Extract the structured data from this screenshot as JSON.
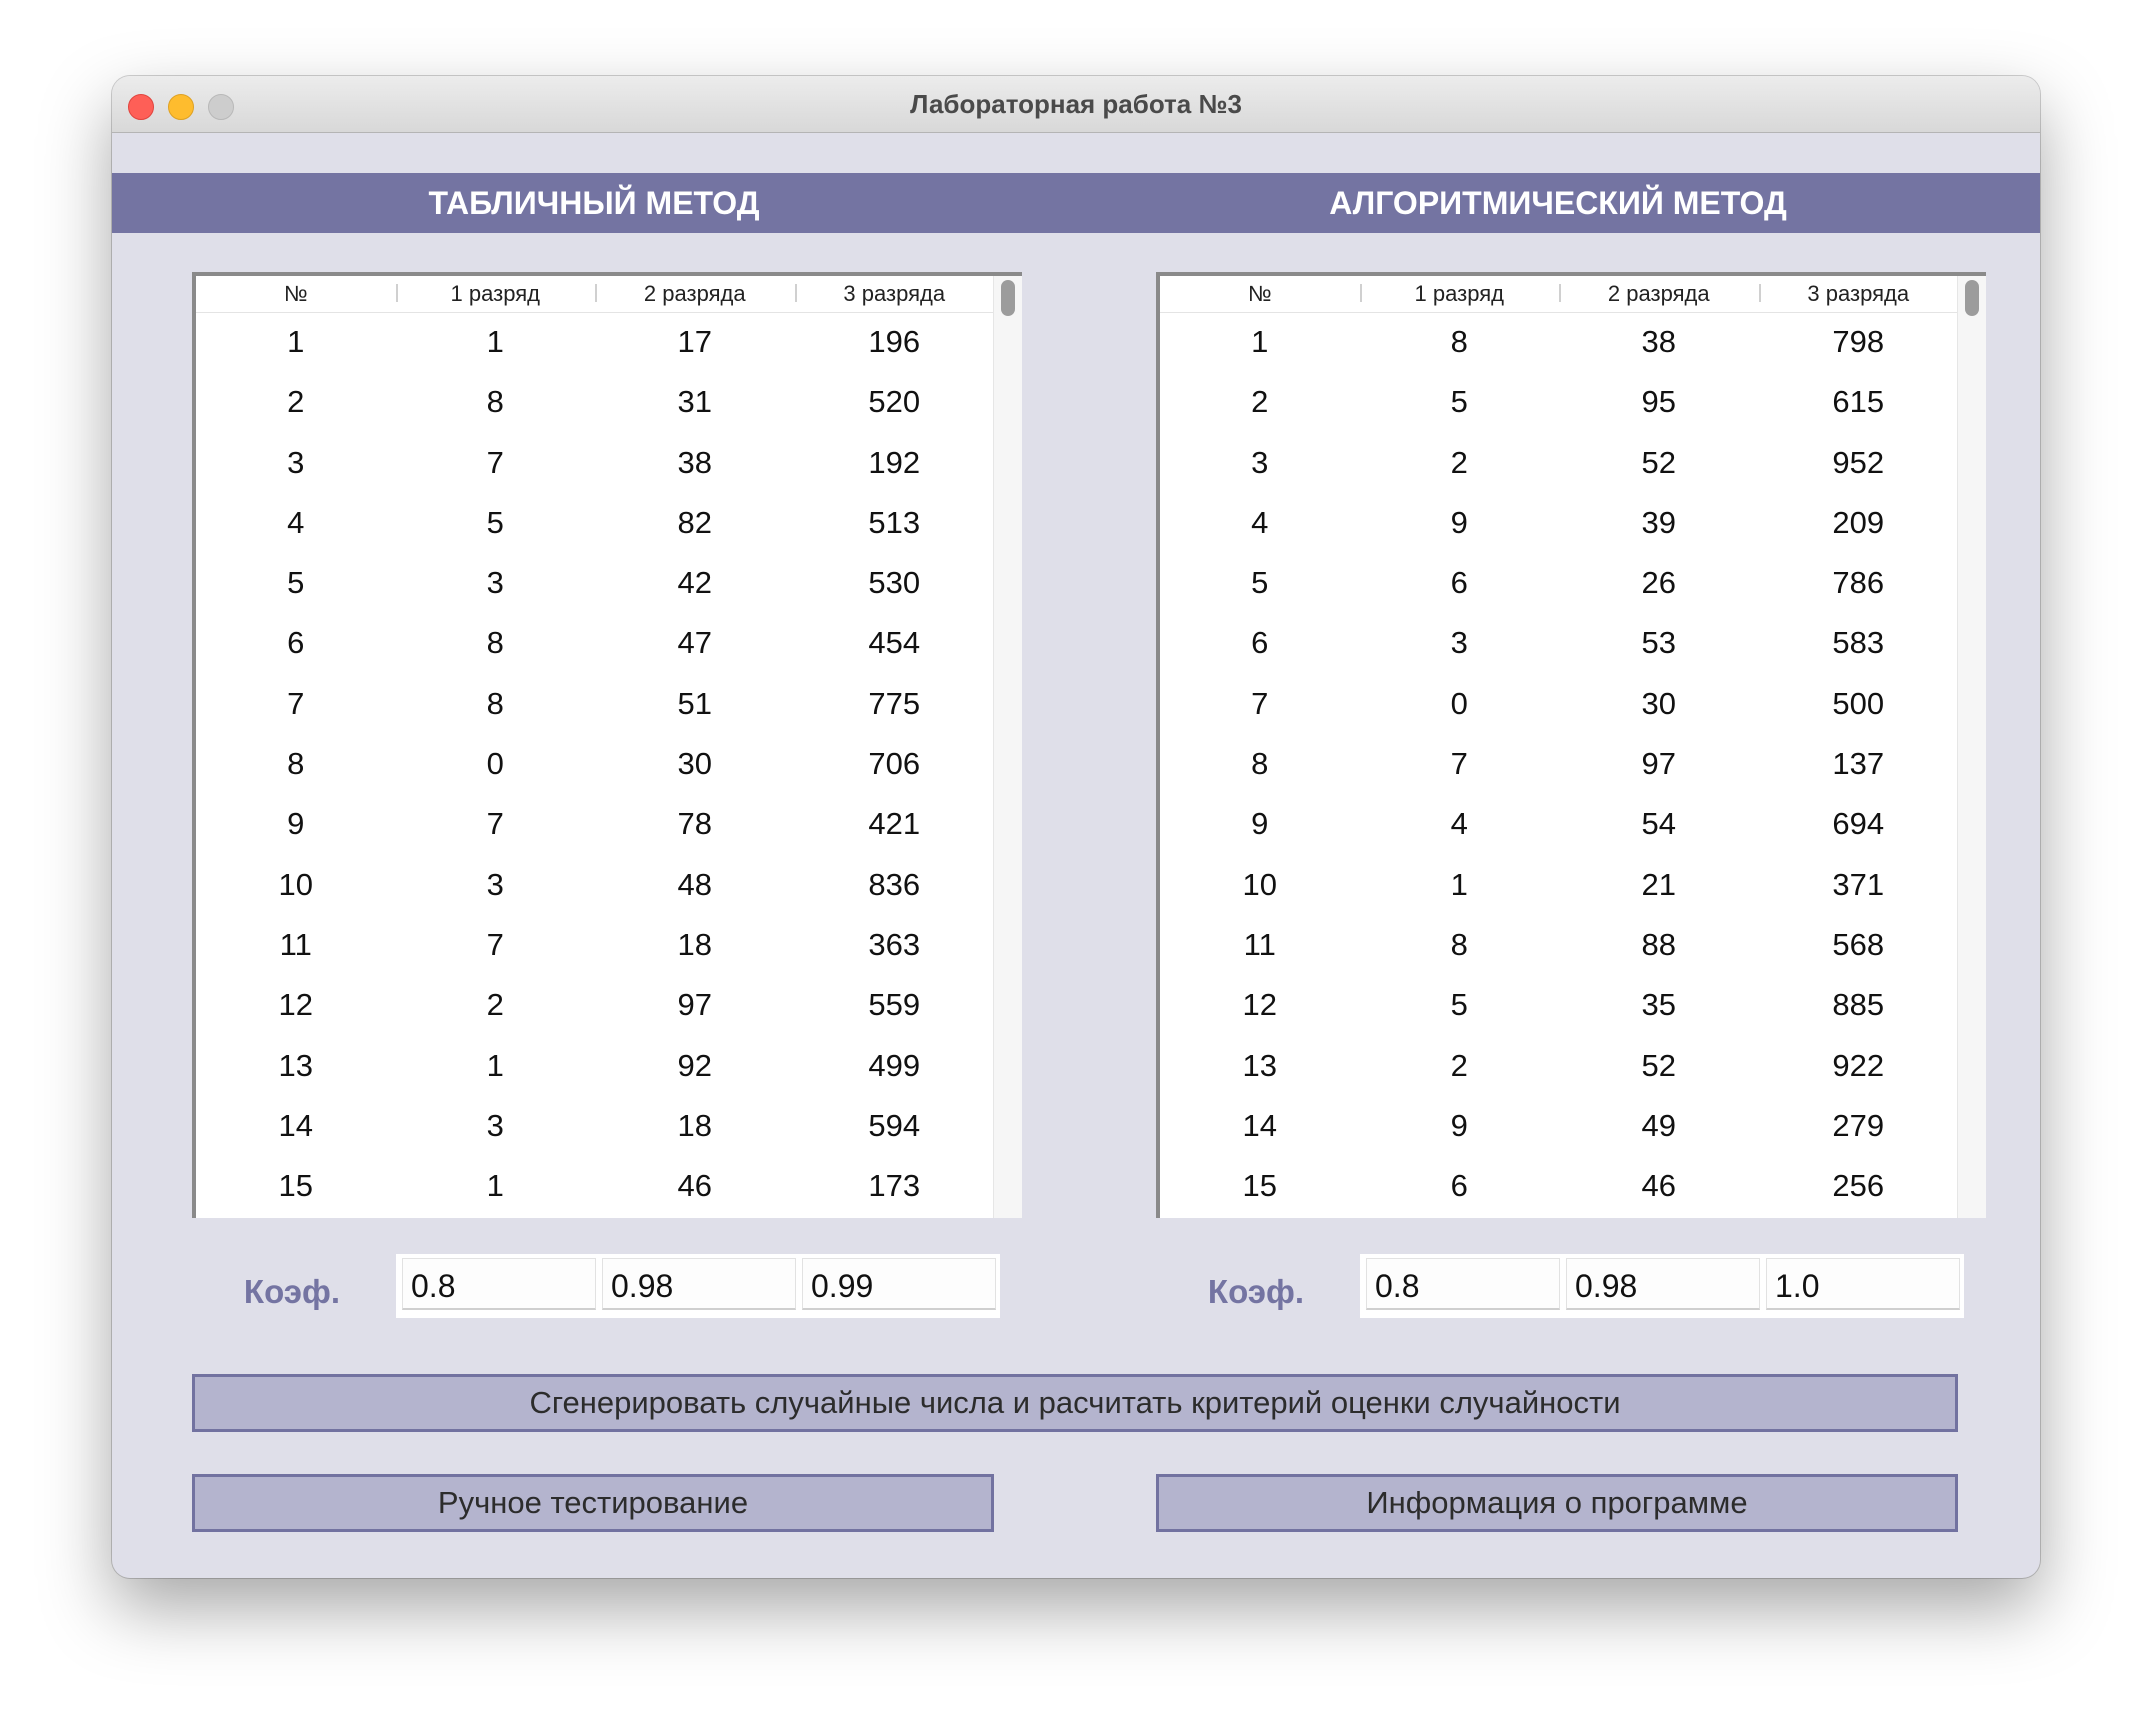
{
  "window": {
    "title": "Лабораторная работа №3"
  },
  "sections": {
    "left_title": "ТАБЛИЧНЫЙ МЕТОД",
    "right_title": "АЛГОРИТМИЧЕСКИЙ МЕТОД"
  },
  "table_headers": [
    "№",
    "1 разряд",
    "2 разряда",
    "3 разряда"
  ],
  "left_table": {
    "rows": [
      [
        "1",
        "1",
        "17",
        "196"
      ],
      [
        "2",
        "8",
        "31",
        "520"
      ],
      [
        "3",
        "7",
        "38",
        "192"
      ],
      [
        "4",
        "5",
        "82",
        "513"
      ],
      [
        "5",
        "3",
        "42",
        "530"
      ],
      [
        "6",
        "8",
        "47",
        "454"
      ],
      [
        "7",
        "8",
        "51",
        "775"
      ],
      [
        "8",
        "0",
        "30",
        "706"
      ],
      [
        "9",
        "7",
        "78",
        "421"
      ],
      [
        "10",
        "3",
        "48",
        "836"
      ],
      [
        "11",
        "7",
        "18",
        "363"
      ],
      [
        "12",
        "2",
        "97",
        "559"
      ],
      [
        "13",
        "1",
        "92",
        "499"
      ],
      [
        "14",
        "3",
        "18",
        "594"
      ],
      [
        "15",
        "1",
        "46",
        "173"
      ]
    ]
  },
  "right_table": {
    "rows": [
      [
        "1",
        "8",
        "38",
        "798"
      ],
      [
        "2",
        "5",
        "95",
        "615"
      ],
      [
        "3",
        "2",
        "52",
        "952"
      ],
      [
        "4",
        "9",
        "39",
        "209"
      ],
      [
        "5",
        "6",
        "26",
        "786"
      ],
      [
        "6",
        "3",
        "53",
        "583"
      ],
      [
        "7",
        "0",
        "30",
        "500"
      ],
      [
        "8",
        "7",
        "97",
        "137"
      ],
      [
        "9",
        "4",
        "54",
        "694"
      ],
      [
        "10",
        "1",
        "21",
        "371"
      ],
      [
        "11",
        "8",
        "88",
        "568"
      ],
      [
        "12",
        "5",
        "35",
        "885"
      ],
      [
        "13",
        "2",
        "52",
        "922"
      ],
      [
        "14",
        "9",
        "49",
        "279"
      ],
      [
        "15",
        "6",
        "46",
        "256"
      ]
    ]
  },
  "coef": {
    "label": "Коэф.",
    "left_values": [
      "0.8",
      "0.98",
      "0.99"
    ],
    "right_values": [
      "0.8",
      "0.98",
      "1.0"
    ]
  },
  "buttons": {
    "generate": "Сгенерировать случайные числа и расчитать критерий оценки случайности",
    "manual": "Ручное тестирование",
    "info": "Информация о программе"
  }
}
